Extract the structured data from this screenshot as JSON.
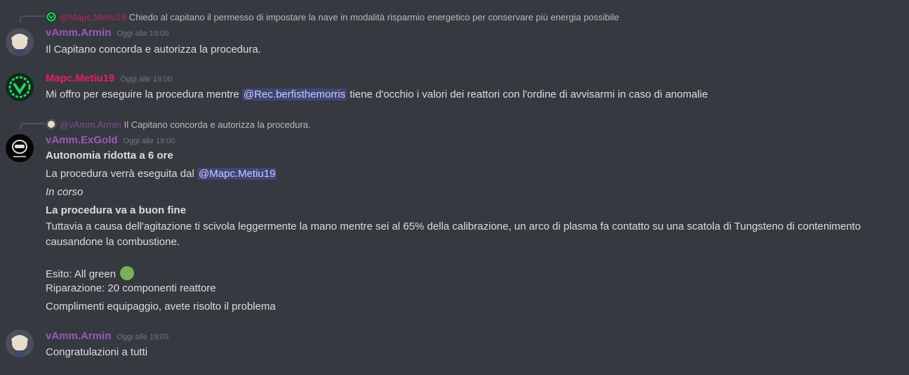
{
  "messages": [
    {
      "reply": {
        "author": "@Mapc.Metiu19",
        "text": "Chiedo al capitano il permesso di impostare la nave in modalità risparmio energetico per conservare più energia possibile"
      },
      "author": "vAmm.Armin",
      "timestamp": "Oggi alle 19:00",
      "text": "Il Capitano concorda e autorizza la procedura."
    },
    {
      "author": "Mapc.Metiu19",
      "timestamp": "Oggi alle 19:00",
      "text_before": "Mi offro per eseguire la procedura mentre ",
      "mention": "@Rec.berfisthemorris",
      "text_after": " tiene d'occhio i valori dei reattori con l'ordine di avvisarmi in caso di anomalie"
    },
    {
      "reply": {
        "author": "@vAmm.Armin",
        "text": "Il Capitano concorda e autorizza la procedura."
      },
      "author": "vAmm.ExGold",
      "timestamp": "Oggi alle 19:00",
      "line1": "Autonomia ridotta a 6 ore",
      "line2_before": "La procedura verrà eseguita dal ",
      "line2_mention": "@Mapc.Metiu19",
      "line3": "In corso",
      "line4": "La procedura va a buon fine",
      "line5": "Tuttavia a causa dell'agitazione ti scivola leggermente la mano mentre sei al 65% della calibrazione, un arco di plasma fa contatto su una scatola di Tungsteno di contenimento",
      "line6": "causandone la combustione.",
      "line7": "Esito: All green",
      "line8": "Riparazione: 20 componenti reattore",
      "line9": "Complimenti equipaggio, avete risolto il problema"
    },
    {
      "author": "vAmm.Armin",
      "timestamp": "Oggi alle 19:03",
      "text": "Congratulazioni a tutti"
    }
  ],
  "icons": {
    "status_emoji": "green-circle-emoji"
  }
}
